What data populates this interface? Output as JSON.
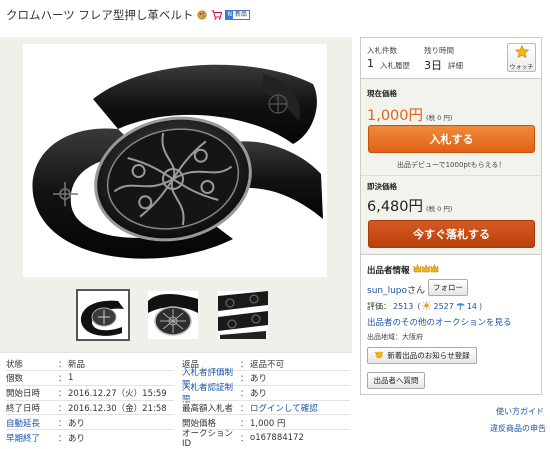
{
  "item": {
    "title": "クロムハーツ フレア型押し革ベルト",
    "badge_left": "N",
    "badge_new": "新品"
  },
  "summary": {
    "bids_label": "入札件数",
    "bids_value": "1",
    "bid_history_link": "入札履歴",
    "time_left_label": "残り時間",
    "time_left_value": "3日",
    "detail_link": "詳細",
    "watch_label": "ウォッチ"
  },
  "price": {
    "current_label": "現在価格",
    "current_value": "1,000円",
    "current_tax": "(税 0 円)",
    "bid_button": "入札する",
    "promo_link": "出品デビューで1000ptもらえる！",
    "buynow_label": "即決価格",
    "buynow_value": "6,480円",
    "buynow_tax": "(税 0 円)",
    "buynow_button": "今すぐ落札する"
  },
  "seller": {
    "heading": "出品者情報",
    "name": "sun_lupo",
    "name_suffix": "さん",
    "follow_button": "フォロー",
    "rating_label": "評価：",
    "rating_value": "2513",
    "good_value": "2527",
    "bad_value": "14",
    "other_auctions_link": "出品者のその他のオークションを見る",
    "region": "出品地域：大阪府",
    "notify_button": "新着出品のお知らせ登録",
    "question_button": "出品者へ質問"
  },
  "details": {
    "left": [
      {
        "key": "状態",
        "value": "新品",
        "link": false
      },
      {
        "key": "個数",
        "value": "1",
        "link": false
      },
      {
        "key": "開始日時",
        "value": "2016.12.27（火）15:59",
        "link": false
      },
      {
        "key": "終了日時",
        "value": "2016.12.30（金）21:58",
        "link": false
      },
      {
        "key": "自動延長",
        "value": "あり",
        "link": true
      },
      {
        "key": "早期終了",
        "value": "あり",
        "link": true
      }
    ],
    "right": [
      {
        "key": "返品",
        "value": "返品不可",
        "link": false
      },
      {
        "key": "入札者評価制限",
        "value": "あり",
        "link": true
      },
      {
        "key": "入札者認証制限",
        "value": "あり",
        "link": true
      },
      {
        "key": "最高額入札者",
        "value": "ログインして確認",
        "link": false
      },
      {
        "key": "開始価格",
        "value": "1,000 円",
        "link": false
      },
      {
        "key": "オークションID",
        "value": "o167884172",
        "link": false
      }
    ]
  },
  "footer": {
    "guide_link": "使い方ガイド",
    "violation_link": "違反商品の申告"
  },
  "colors": {
    "accent_orange": "#e0641d",
    "link_blue": "#1a55a8"
  }
}
